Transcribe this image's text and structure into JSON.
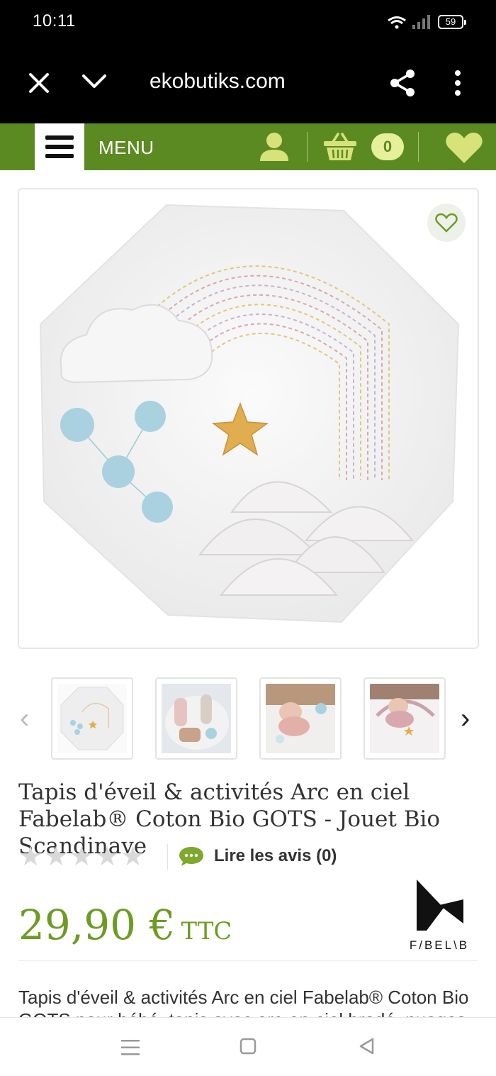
{
  "status_bar": {
    "time": "10:11",
    "battery": "59"
  },
  "browser": {
    "url": "ekobutiks.com",
    "icons": [
      "close-icon",
      "chevron-down-icon",
      "share-icon",
      "more-vertical-icon"
    ]
  },
  "site_nav": {
    "menu_label": "MENU",
    "cart_count": "0",
    "brand_color": "#5c8a22",
    "icons": [
      "hamburger-icon",
      "user-icon",
      "basket-icon",
      "heart-icon"
    ]
  },
  "product": {
    "title": "Tapis d'éveil & activités Arc en ciel Fabelab® Coton Bio GOTS - Jouet Bio Scandinave",
    "rating": {
      "stars": 0,
      "max": 5
    },
    "reviews_label": "Lire les avis (0)",
    "price": "29,90 €",
    "price_suffix": "TTC",
    "price_color": "#6e9b24",
    "brand": "F/BEL\\B",
    "description": "Tapis d'éveil & activités Arc en ciel Fabelab® Coton Bio GOTS pour bébé, tapis avec arc-en-ciel brodé, nuages et étoile."
  },
  "gallery": {
    "prev_arrow": "‹",
    "next_arrow": "›"
  }
}
